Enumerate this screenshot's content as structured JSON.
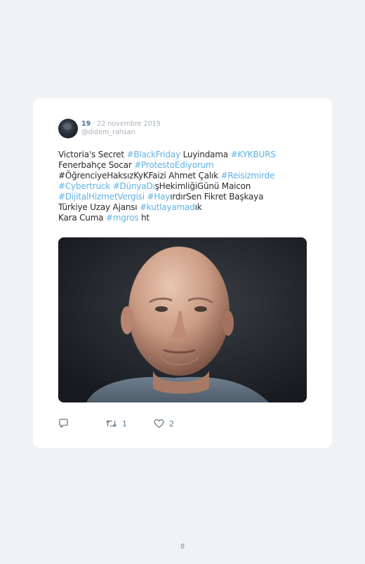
{
  "tweet": {
    "user_number": "19",
    "separator": " · ",
    "date": "22 novembre 2019",
    "handle": "@didem_rahsan",
    "lines": [
      [
        {
          "t": "Victoria's Secret "
        },
        {
          "t": "#BlackFriday",
          "h": true
        },
        {
          "t": " Luyindama "
        },
        {
          "t": "#KYKBURS",
          "h": true
        }
      ],
      [
        {
          "t": "Fenerbahçe Socar "
        },
        {
          "t": "#ProtestoEdiyorum",
          "h": true
        }
      ],
      [
        {
          "t": "#ÖğrenciyeHaksızKyKFaizi Ahmet Çalık "
        },
        {
          "t": "#Reisizmirde",
          "h": true
        }
      ],
      [
        {
          "t": "#Cybertruck",
          "h": true
        },
        {
          "t": " "
        },
        {
          "t": "#DünyaDı",
          "h": true
        },
        {
          "t": "şHekimliğiGünü Maicon"
        }
      ],
      [
        {
          "t": "#DijitalHizmetVergisi",
          "h": true
        },
        {
          "t": " "
        },
        {
          "t": "#Hay",
          "h": true
        },
        {
          "t": "ırdırSen Fikret Başkaya"
        }
      ],
      [
        {
          "t": "Türkiye Uzay Ajansı "
        },
        {
          "t": "#kutlayamad",
          "h": true
        },
        {
          "t": "ık"
        }
      ],
      [
        {
          "t": "Kara Cuma "
        },
        {
          "t": "#mgros",
          "h": true
        },
        {
          "t": " ht"
        }
      ]
    ],
    "retweet_count": "1",
    "like_count": "2"
  },
  "icons": {
    "reply": "reply-icon",
    "retweet": "retweet-icon",
    "like": "heart-icon"
  },
  "colors": {
    "hashtag": "#5fb2e6",
    "background": "#f1f2f4",
    "card": "#ffffff"
  },
  "page_number": "8"
}
